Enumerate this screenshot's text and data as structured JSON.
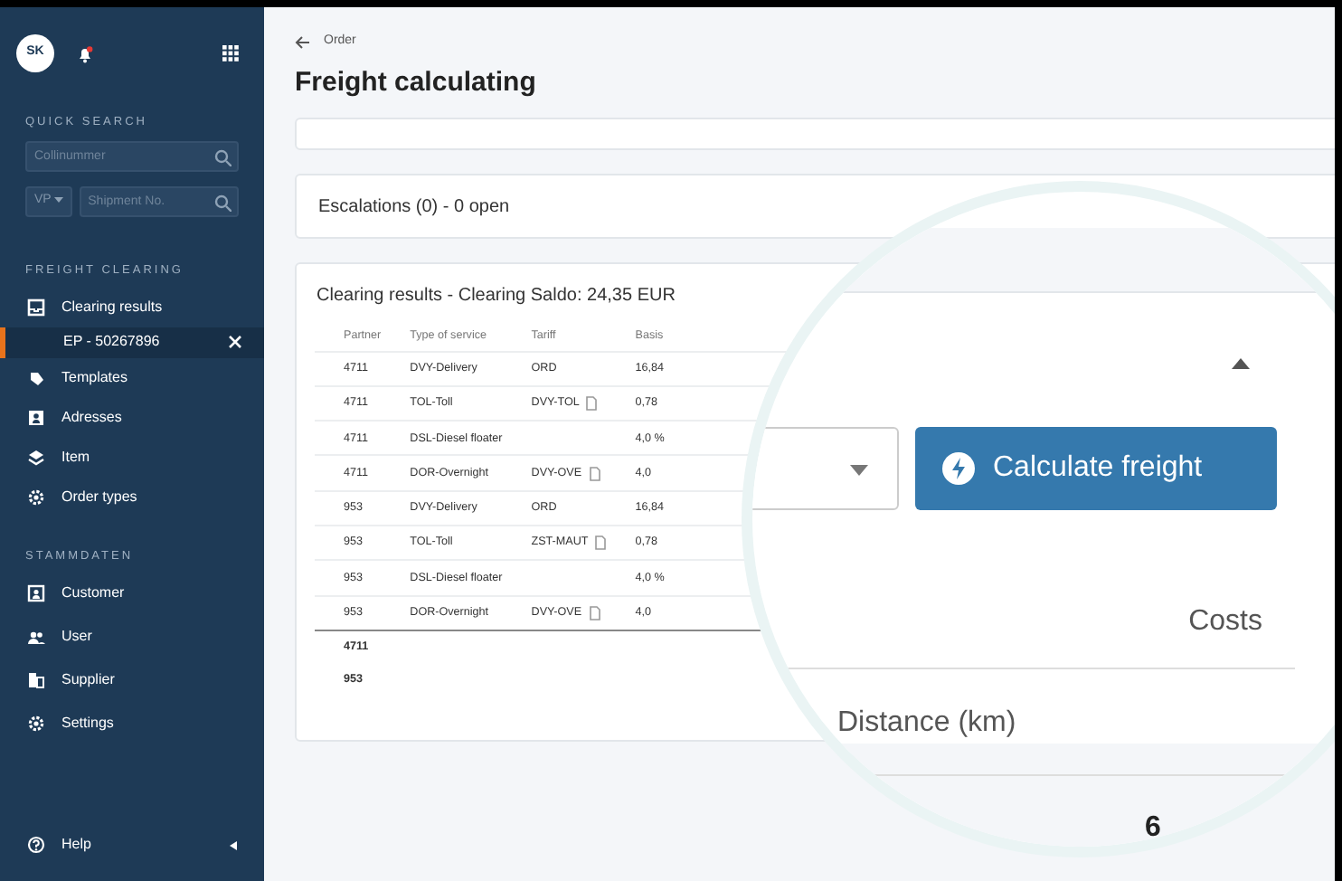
{
  "sidebar": {
    "avatar": "SK",
    "notification": true,
    "quick_search": {
      "heading": "QUICK SEARCH",
      "collinummer": {
        "placeholder": "Collinummer"
      },
      "prefix": {
        "value": "VP"
      },
      "shipment": {
        "placeholder": "Shipment No."
      }
    },
    "sections": [
      {
        "heading": "FREIGHT CLEARING",
        "items": [
          {
            "label": "Clearing results",
            "selected": false,
            "children": [
              {
                "label": "EP - 50267896",
                "selected": true
              }
            ]
          },
          {
            "label": "Templates",
            "selected": false
          },
          {
            "label": "Adresses",
            "selected": false
          },
          {
            "label": "Item",
            "selected": false
          },
          {
            "label": "Order types",
            "selected": false
          }
        ]
      },
      {
        "heading": "STAMMDATEN",
        "items": [
          {
            "label": "Customer",
            "selected": false
          },
          {
            "label": "User",
            "selected": false
          },
          {
            "label": "Supplier",
            "selected": false
          },
          {
            "label": "Settings",
            "selected": false
          }
        ]
      }
    ],
    "help": "Help"
  },
  "page": {
    "breadcrumb": "Order",
    "title": "Freight calculating"
  },
  "escalations": {
    "title": "Escalations (0) - 0 open"
  },
  "clearing": {
    "title": "Clearing results - Clearing Saldo: 24,35 EUR",
    "columns": [
      "Partner",
      "Type of service",
      "Tariff",
      "Basis"
    ],
    "rows": [
      {
        "partner": "4711",
        "service": "DVY-Delivery",
        "tariff": "ORD",
        "document": false,
        "basis": "16,84"
      },
      {
        "partner": "4711",
        "service": "TOL-Toll",
        "tariff": "DVY-TOL",
        "document": true,
        "basis": "0,78"
      },
      {
        "partner": "4711",
        "service": "DSL-Diesel floater",
        "document": false,
        "basis": "4,0 %"
      },
      {
        "partner": "4711",
        "service": "DOR-Overnight",
        "tariff": "DVY-OVE",
        "document": true,
        "basis": "4,0"
      },
      {
        "partner": "953",
        "service": "DVY-Delivery",
        "tariff": "ORD",
        "document": false,
        "basis": "16,84"
      },
      {
        "partner": "953",
        "service": "TOL-Toll",
        "tariff": "ZST-MAUT",
        "document": true,
        "basis": "0,78"
      },
      {
        "partner": "953",
        "service": "DSL-Diesel floater",
        "document": false,
        "basis": "4,0 %"
      },
      {
        "partner": "953",
        "service": "DOR-Overnight",
        "tariff": "DVY-OVE",
        "document": true,
        "basis": "4,0"
      }
    ],
    "totals": [
      "4711",
      "953"
    ]
  },
  "magnifier": {
    "expanded": true,
    "button": "Calculate freight",
    "costs_label": "Costs",
    "distance_label": "Distance (km)",
    "value": "6"
  }
}
